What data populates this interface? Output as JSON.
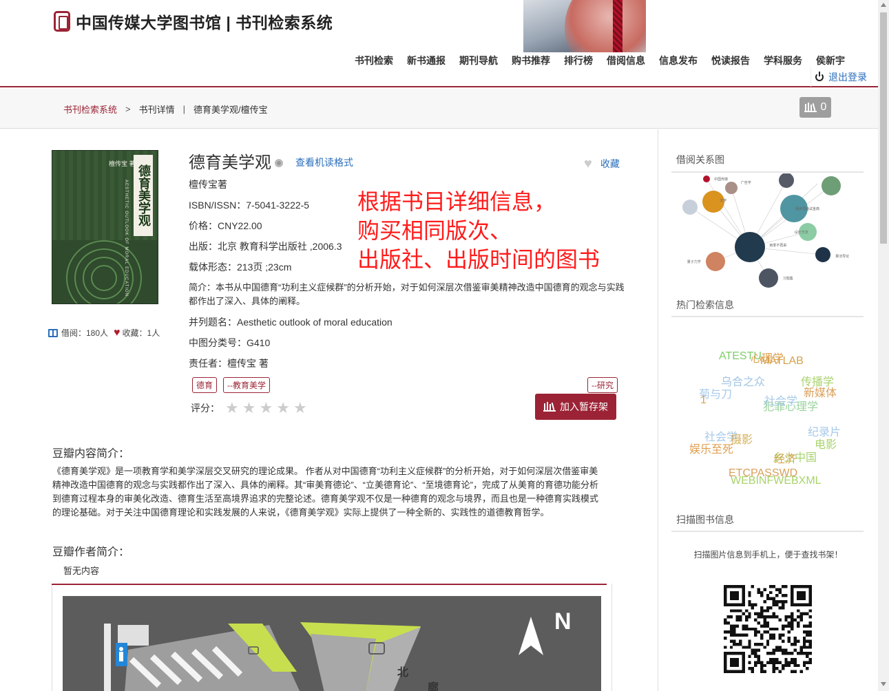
{
  "header": {
    "site_title": "中国传媒大学图书馆 | 书刊检索系统",
    "nav": [
      "书刊检索",
      "新书通报",
      "期刊导航",
      "购书推荐",
      "排行榜",
      "借阅信息",
      "信息发布",
      "悦读报告",
      "学科服务",
      "侯新宇"
    ],
    "logout": "退出登录"
  },
  "breadcrumb": {
    "home": "书刊检索系统",
    "arrow": ">",
    "detail": "书刊详情",
    "bar": "|",
    "current": "德育美学观/檀传宝"
  },
  "shelf": {
    "count": "0"
  },
  "book": {
    "cover_title": "德育美学观",
    "cover_author": "檀传宝 著",
    "cover_english": "AESTHETIC OUTLOOK OF MORAL EDUCATION",
    "title": "德育美学观",
    "marc_link": "查看机读格式",
    "favorite": "收藏",
    "stats": {
      "borrow": "借阅：180人",
      "collect": "收藏：1人"
    },
    "fields": {
      "author": "檀传宝著",
      "isbn": "ISBN/ISSN：7-5041-3222-5",
      "price": "价格：CNY22.00",
      "publish": "出版：北京 教育科学出版社 ,2006.3",
      "form": "载体形态：213页 ;23cm",
      "summary": "简介：本书从中国德育“功利主义症候群”的分析开始，对于如何深层次借鉴审美精神改造中国德育的观念与实践都作出了深入、具体的阐释。",
      "parallel_title": "并列题名：Aesthetic outlook of moral education",
      "clc": "中图分类号：G410",
      "responsible": "责任者：檀传宝 著"
    },
    "tags": [
      "德育",
      "--教育美学"
    ],
    "tag_right": "--研究",
    "rating_label": "评分：",
    "stars": 5,
    "add_button": "加入暂存架"
  },
  "annotation": [
    "根据书目详细信息，",
    "购买相同版次、",
    "出版社、出版时间的图书"
  ],
  "douban": {
    "intro_heading": "豆瓣内容简介：",
    "intro": "《德育美学观》是一项教育学和美学深层交叉研究的理论成果。 作者从对中国德育“功利主义症候群”的分析开始，对于如何深层次借鉴审美精神改造中国德育的观念与实践都作出了深入、具体的阐释。其“审美育德论”、“立美德育论”、“至境德育论”，完成了从美育的育德功能分析到德育过程本身的审美化改造、德育生活至高境界追求的完整论述。德育美学观不仅是一种德育的观念与境界，而且也是一种德育实践模式的理论基础。对于关注中国德育理论和实践发展的人来说，《德育美学观》实际上提供了一种全新的、实践性的道德教育哲学。",
    "author_heading": "豆瓣作者简介：",
    "author": "暂无内容"
  },
  "map": {
    "north": "N",
    "char1": "北",
    "char2": "廊"
  },
  "sidebar": {
    "graph_title": "借阅关系图",
    "graph_nodes": [
      {
        "label": "中国传媒",
        "color": "#b3122b"
      },
      {
        "label": "广告学",
        "color": "#a98f86"
      },
      {
        "label": "传播学",
        "color": "#555a66"
      },
      {
        "label": "英语语法大全",
        "color": "#999"
      },
      {
        "label": "",
        "color": "#6e9e76"
      },
      {
        "label": "文学",
        "color": "#d9931e"
      },
      {
        "label": "",
        "color": "#c7d0da"
      },
      {
        "label": "程序员面试金典",
        "color": "#4f96a2"
      },
      {
        "label": "设计方法",
        "color": "#8ccca4"
      },
      {
        "label": "雨季不再来",
        "color": "#213a4d"
      },
      {
        "label": "算法导论",
        "color": "#1f3348"
      },
      {
        "label": "量子力学",
        "color": "#cf8360"
      },
      {
        "label": "习题集",
        "color": "#4c5561"
      }
    ],
    "hot_title": "热门检索信息",
    "hot_words": [
      {
        "text": "ATESTU",
        "color": "#7fce69"
      },
      {
        "text": "心理学",
        "color": "#e0a050"
      },
      {
        "text": "MATLAB",
        "color": "#d5a24a"
      },
      {
        "text": "乌合之众",
        "color": "#9fc4e4"
      },
      {
        "text": "传播学",
        "color": "#a8d36c"
      },
      {
        "text": "菊与刀",
        "color": "#a6c9ea"
      },
      {
        "text": "新媒体",
        "color": "#d9a05a"
      },
      {
        "text": "1",
        "color": "#e0a050"
      },
      {
        "text": "社会学",
        "color": "#a6c9ea"
      },
      {
        "text": "犯罪心理学",
        "color": "#9ad49c"
      },
      {
        "text": "纪录片",
        "color": "#a6c9ea"
      },
      {
        "text": "社会学",
        "color": "#a6c9ea"
      },
      {
        "text": "摄影",
        "color": "#d6b05a"
      },
      {
        "text": "电影",
        "color": "#a8d36c"
      },
      {
        "text": "娱乐至死",
        "color": "#e0a050"
      },
      {
        "text": "乡土中国",
        "color": "#a8d36c"
      },
      {
        "text": "经济",
        "color": "#d5a24a"
      },
      {
        "text": "ETCPASSWD",
        "color": "#d9a05a"
      },
      {
        "text": "WEBINFWEBXML",
        "color": "#a8d36c"
      }
    ],
    "scan_title": "扫描图书信息",
    "scan_text": "扫描图片信息到手机上，便于查找书架！"
  },
  "colors": {
    "brand": "#9b2335",
    "link": "#2a6ebb",
    "annotation": "#ff1b1b"
  }
}
